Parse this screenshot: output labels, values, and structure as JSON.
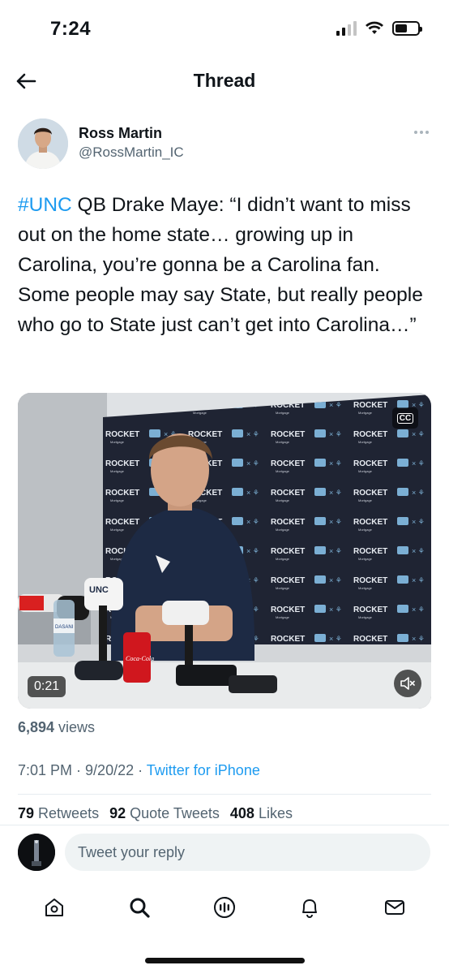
{
  "status_bar": {
    "time": "7:24"
  },
  "header": {
    "title": "Thread"
  },
  "tweet": {
    "author_name": "Ross Martin",
    "author_handle": "@RossMartin_IC",
    "hashtag": "#UNC",
    "text": " QB Drake Maye: “I didn’t want to miss out on the home state… growing up in Carolina, you’re gonna be a Carolina fan. Some people may say State, but really people who go to State just can’t get into Carolina…”",
    "video": {
      "duration": "0:21",
      "backdrop_brand": "ROCKET",
      "backdrop_sub": "Mortgage",
      "cup_text": "Coca-Cola",
      "mic_flag": "UNC",
      "bottle_label": "DASANI"
    },
    "views_count": "6,894",
    "views_label": " views",
    "time": "7:01 PM",
    "date": "9/20/22",
    "source": "Twitter for iPhone",
    "stats": {
      "retweets_count": "79",
      "retweets_label": "Retweets",
      "quotes_count": "92",
      "quotes_label": "Quote Tweets",
      "likes_count": "408",
      "likes_label": "Likes"
    }
  },
  "reply": {
    "placeholder": "Tweet your reply"
  },
  "tab_bar": [
    "home-icon",
    "search-icon",
    "spaces-icon",
    "notifications-icon",
    "messages-icon"
  ],
  "colors": {
    "accent": "#1d9bf0",
    "text": "#0f1419",
    "muted": "#536471"
  }
}
